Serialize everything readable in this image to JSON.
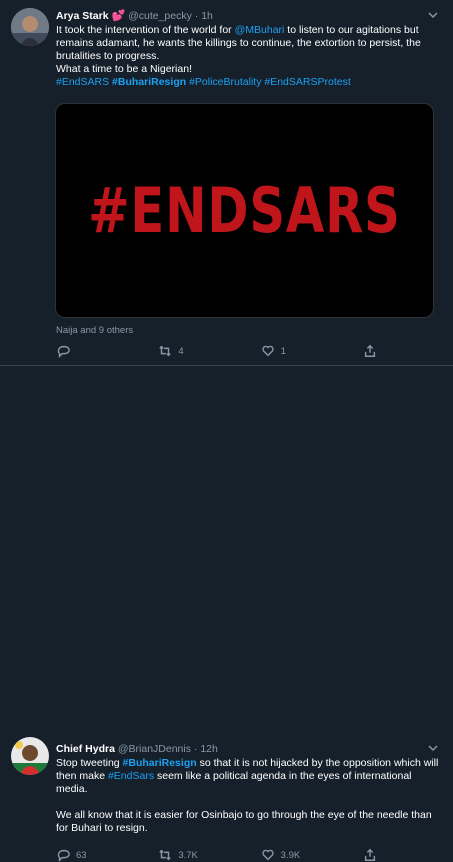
{
  "tweets": [
    {
      "name": "Arya Stark",
      "name_emoji": "💕",
      "handle": "@cute_pecky",
      "separator": "·",
      "time": "1h",
      "text_prefix": "It took the intervention of the world for ",
      "mention": "@MBuhari",
      "text_suffix": " to listen to our agitations but remains adamant, he wants the killings to continue, the extortion to persist, the brutalities to progress.\nWhat a time to be a Nigerian!\n",
      "hashtag_1": "#EndSARS",
      "hashtag_2": "#BuhariResign",
      "hashtag_3": "#PoliceBrutality",
      "hashtag_4": "#EndSARSProtest",
      "media_text": "#ENDSARS",
      "social_context": "Naija and 9 others",
      "replies": "",
      "retweets": "4",
      "likes": "1"
    },
    {
      "name": "Chief Hydra",
      "handle": "@BrianJDennis",
      "separator": "·",
      "time": "12h",
      "text_1": "Stop tweeting ",
      "hashtag_1": "#BuhariResign",
      "text_2": " so that it is not hijacked by the opposition which will then make ",
      "hashtag_2": "#EndSars",
      "text_3": " seem like a political agenda in the eyes of international media.\n\nWe all know that it is easier for Osinbajo to go through the eye of the needle than for Buhari to resign.",
      "replies": "63",
      "retweets": "3.7K",
      "likes": "3.9K"
    }
  ],
  "icons": {
    "caret": "chevron-down-icon",
    "reply": "reply-icon",
    "retweet": "retweet-icon",
    "like": "heart-icon",
    "share": "share-icon"
  },
  "colors": {
    "background": "#15202b",
    "accent": "#1da1f2",
    "muted": "#8899a6",
    "media_text": "#c0151b"
  }
}
